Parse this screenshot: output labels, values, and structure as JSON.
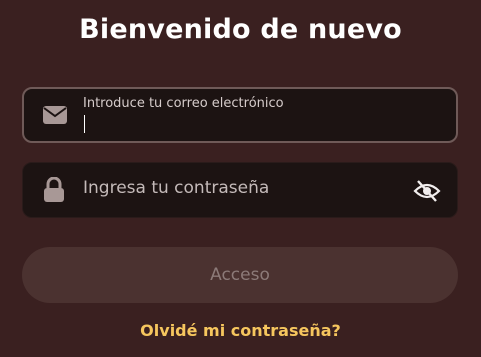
{
  "header": {
    "title": "Bienvenido de nuevo"
  },
  "email_field": {
    "label": "Introduce tu correo electrónico",
    "value": "",
    "icon": "envelope-icon"
  },
  "password_field": {
    "placeholder": "Ingresa tu contraseña",
    "icon": "lock-icon",
    "toggle_icon": "eye-slash-icon"
  },
  "submit": {
    "label": "Acceso"
  },
  "forgot": {
    "label": "Olvidé mi contraseña?"
  },
  "colors": {
    "background": "#3a2020",
    "field_background": "#1c1312",
    "button_background": "#4b3230",
    "link": "#f6c65e"
  }
}
